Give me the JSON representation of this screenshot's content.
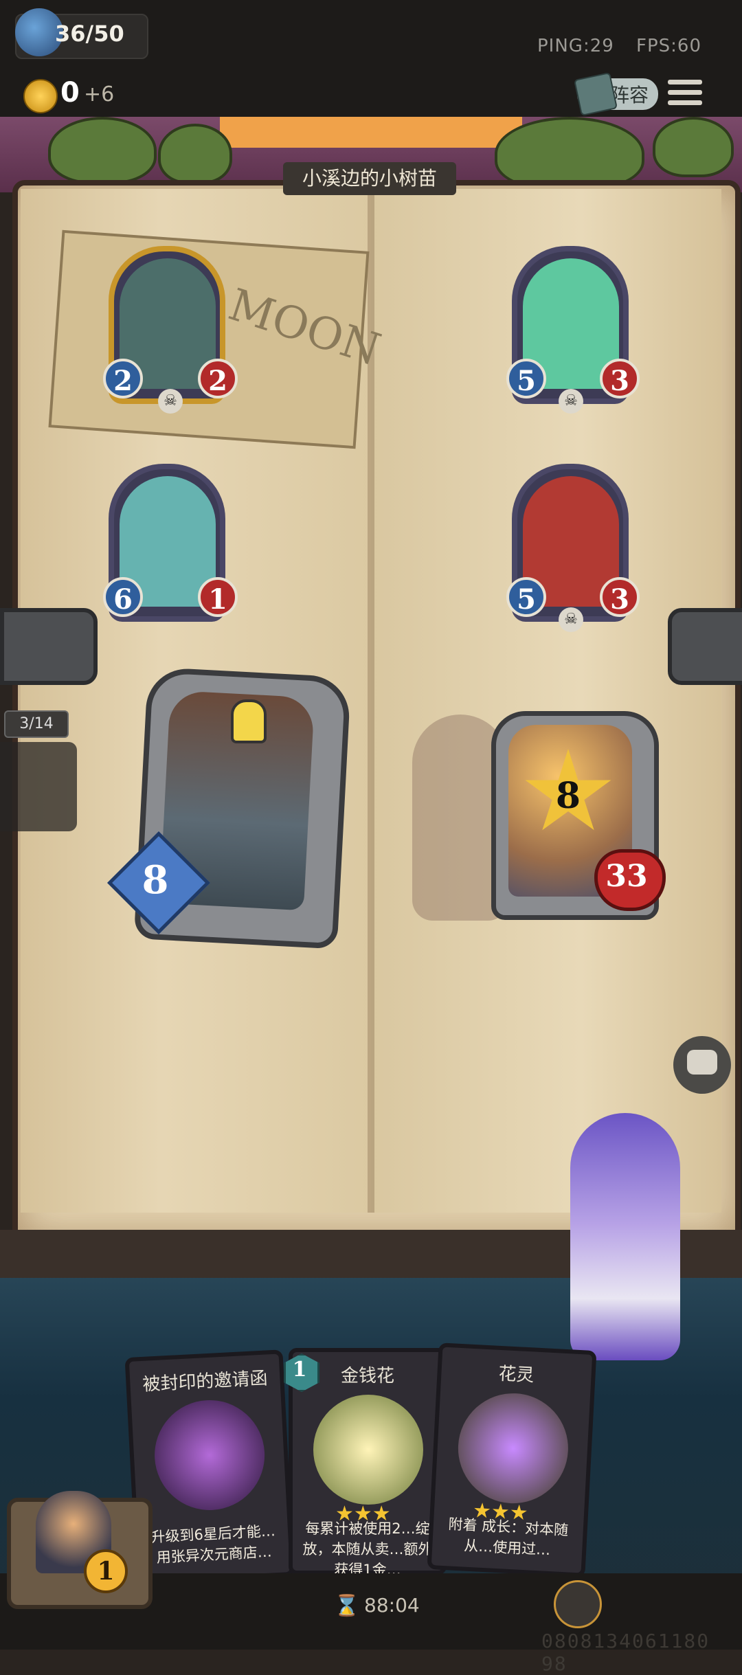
{
  "topbar": {
    "health": "36/50",
    "gold": "0",
    "gold_income": "+6",
    "ping": "PING:29",
    "fps": "FPS:60",
    "lineup_label": "阵容"
  },
  "board": {
    "stage_title": "小溪边的小树苗",
    "sign_text": "MOON",
    "page_indicator": "3/14",
    "enemy_minions": [
      {
        "attack": "2",
        "health": "2",
        "art_color": "#4c6e6a",
        "frame": "gold",
        "has_skull": true
      },
      {
        "attack": "5",
        "health": "3",
        "art_color": "#5ec89f",
        "frame": "silver",
        "has_skull": true
      },
      {
        "attack": "6",
        "health": "1",
        "art_color": "#66b3b0",
        "frame": "silver",
        "has_skull": false
      },
      {
        "attack": "5",
        "health": "3",
        "art_color": "#b23a33",
        "frame": "silver",
        "has_skull": true
      }
    ],
    "player_hero": {
      "attack": "8"
    },
    "enemy_hero": {
      "attack": "8",
      "health": "33"
    }
  },
  "shop": {
    "cards": [
      {
        "name": "被封印的邀请函",
        "desc": "升级到6星后才能…用张异次元商店…",
        "stars": 0,
        "orb_color": "#6a2f8e"
      },
      {
        "name": "金钱花",
        "desc": "每累计被使用2…绽放，本随从卖…额外获得1金…",
        "stars": 3,
        "orb_color": "#f0d050"
      },
      {
        "name": "花灵",
        "desc": "附着 成长：对本随从…使用过…",
        "stars": 3,
        "orb_color": "#8a3fc7"
      }
    ],
    "tier": "1"
  },
  "bottom": {
    "timer": "88:04",
    "player_gold": "1",
    "id_text": "0808134061180 98"
  },
  "colors": {
    "attack": "#2f5e9c",
    "health": "#b22a2a",
    "gold": "#f2b534"
  }
}
